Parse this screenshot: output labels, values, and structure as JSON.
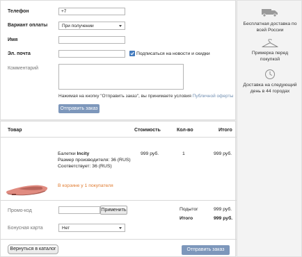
{
  "form": {
    "phone_label": "Телефон",
    "phone_value": "+7",
    "payment_label": "Вариант оплаты",
    "payment_value": "При получении",
    "name_label": "Имя",
    "email_label": "Эл. почта",
    "subscribe_label": "Подписаться на новости и скидки",
    "comment_label": "Комментарий",
    "terms_text": "Нажимая на кнопку \"Отправить заказ\", вы принимаете условия",
    "terms_link": "Публичной оферты",
    "submit_label": "Отправить заказ"
  },
  "cart": {
    "headers": {
      "product": "Товар",
      "price": "Стоимость",
      "qty": "Кол-во",
      "total": "Итого"
    },
    "item": {
      "name_prefix": "Балетки",
      "brand": "Incity",
      "size_line": "Размер производителя: 36 (RUS)",
      "fit_line": "Соответствует: 36 (RUS)",
      "price": "999 руб.",
      "qty": "1",
      "total": "999 руб.",
      "cart_note": "В корзине у 1 покупателя"
    },
    "promo_label": "Промо-код",
    "promo_apply_label": "Применить",
    "bonus_label": "Бонусная карта",
    "bonus_value": "Нет",
    "subtotal_label": "Подытог",
    "subtotal_value": "999 руб.",
    "total_label": "Итого",
    "total_value": "999 руб."
  },
  "footer": {
    "back_label": "Вернуться в каталог",
    "submit_label": "Отправить заказ"
  },
  "sidebar": {
    "items": [
      {
        "icon": "truck-icon",
        "text": "Бесплатная доставка по всей России"
      },
      {
        "icon": "hanger-icon",
        "text": "Примерка перед покупкой"
      },
      {
        "icon": "clock-icon",
        "text": "Доставка на следующий день в 44 городах"
      }
    ]
  },
  "colors": {
    "accent_button": "#7d97bb",
    "link": "#6f8db0",
    "note_orange": "#e07a2e",
    "shoe": "#e08b80"
  }
}
